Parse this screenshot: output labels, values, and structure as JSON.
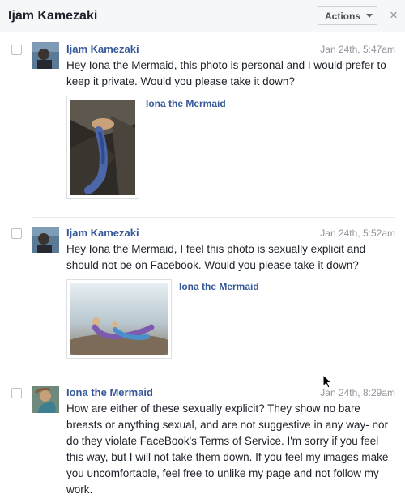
{
  "header": {
    "title": "Ijam Kamezaki",
    "actions_label": "Actions",
    "close_glyph": "×"
  },
  "messages": [
    {
      "sender": "Ijam Kamezaki",
      "timestamp": "Jan 24th, 5:47am",
      "text": "Hey Iona the Mermaid, this photo is personal and I would prefer to keep it private. Would you please take it down?",
      "attachment_owner": "Iona the Mermaid"
    },
    {
      "sender": "Ijam Kamezaki",
      "timestamp": "Jan 24th, 5:52am",
      "text": "Hey Iona the Mermaid, I feel this photo is sexually explicit and should not be on Facebook. Would you please take it down?",
      "attachment_owner": "Iona the Mermaid"
    },
    {
      "sender": "Iona the Mermaid",
      "timestamp": "Jan 24th, 8:29am",
      "text": "How are either of these sexually explicit? They show no bare breasts or anything sexual, and are not suggestive in any way- nor do they violate FaceBook's Terms of Service. I'm sorry if you feel this way, but I will not take them down. If you feel my images make you uncomfortable, feel free to unlike my page and not follow my work."
    }
  ]
}
